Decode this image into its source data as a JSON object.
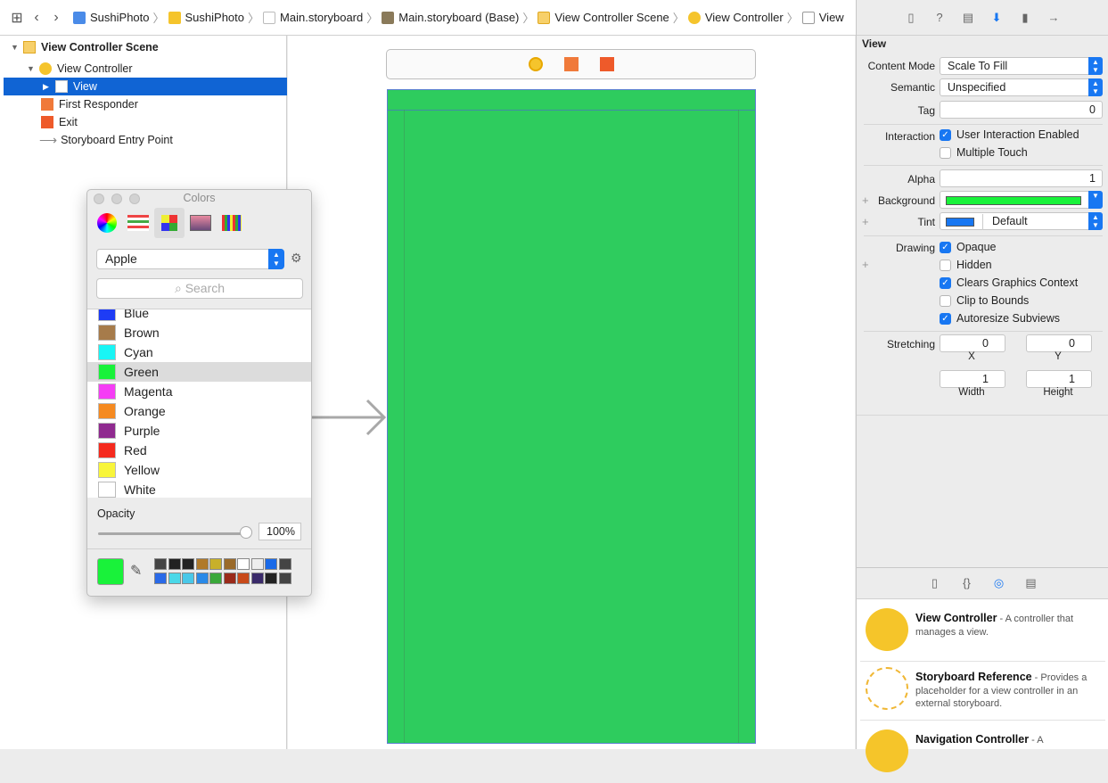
{
  "breadcrumb": [
    "SushiPhoto",
    "SushiPhoto",
    "Main.storyboard",
    "Main.storyboard (Base)",
    "View Controller Scene",
    "View Controller",
    "View"
  ],
  "outline": {
    "scene": "View Controller Scene",
    "controller": "View Controller",
    "view": "View",
    "first_responder": "First Responder",
    "exit": "Exit",
    "entry": "Storyboard Entry Point"
  },
  "colors_panel": {
    "title": "Colors",
    "palette": "Apple",
    "search_placeholder": "Search",
    "items": [
      {
        "name": "Blue",
        "hex": "#1e3cf5"
      },
      {
        "name": "Brown",
        "hex": "#a67b4a"
      },
      {
        "name": "Cyan",
        "hex": "#19f5f5"
      },
      {
        "name": "Green",
        "hex": "#19f23a"
      },
      {
        "name": "Magenta",
        "hex": "#f53df5"
      },
      {
        "name": "Orange",
        "hex": "#f58a21"
      },
      {
        "name": "Purple",
        "hex": "#8f2a8f"
      },
      {
        "name": "Red",
        "hex": "#f52a1e"
      },
      {
        "name": "Yellow",
        "hex": "#f8f53a"
      },
      {
        "name": "White",
        "hex": "#ffffff"
      }
    ],
    "selected": "Green",
    "opacity_label": "Opacity",
    "opacity_value": "100%",
    "opacity_fraction": 1.0,
    "current_color": "#19f23a"
  },
  "inspector": {
    "section": "View",
    "content_mode_label": "Content Mode",
    "content_mode": "Scale To Fill",
    "semantic_label": "Semantic",
    "semantic": "Unspecified",
    "tag_label": "Tag",
    "tag": "0",
    "interaction_label": "Interaction",
    "user_interaction": "User Interaction Enabled",
    "multiple_touch": "Multiple Touch",
    "alpha_label": "Alpha",
    "alpha": "1",
    "background_label": "Background",
    "background_color": "#19f23a",
    "tint_label": "Tint",
    "tint": "Default",
    "tint_color": "#1877f2",
    "drawing_label": "Drawing",
    "opaque": "Opaque",
    "hidden": "Hidden",
    "clears": "Clears Graphics Context",
    "clip": "Clip to Bounds",
    "autoresize": "Autoresize Subviews",
    "stretching_label": "Stretching",
    "stretch_x": "0",
    "stretch_y": "0",
    "stretch_w": "1",
    "stretch_h": "1",
    "x_label": "X",
    "y_label": "Y",
    "width_label": "Width",
    "height_label": "Height"
  },
  "library": [
    {
      "title": "View Controller",
      "desc": " - A controller that manages a view."
    },
    {
      "title": "Storyboard Reference",
      "desc": " - Provides a placeholder for a view controller in an external storyboard."
    },
    {
      "title": "Navigation Controller",
      "desc": " - A"
    }
  ]
}
